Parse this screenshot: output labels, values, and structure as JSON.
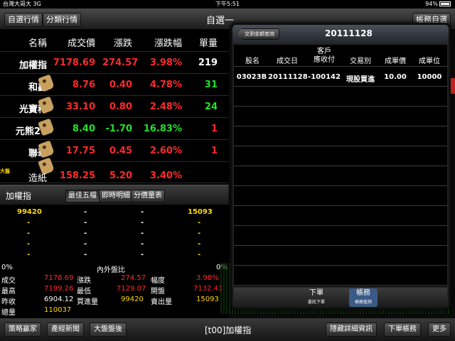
{
  "status": {
    "carrier": "台灣大哥大 3G",
    "time": "下午5:51",
    "battery": "94%"
  },
  "toolbar": {
    "left_tab_1": "自選行情",
    "left_tab_2": "分類行情",
    "title": "自選一",
    "right_btn": "帳務自選"
  },
  "quote_table": {
    "headers": [
      "名稱",
      "成交價",
      "漲跌",
      "漲跌幅",
      "單量"
    ],
    "rows": [
      {
        "name": "加權指",
        "price": "7178.69",
        "change": "274.57",
        "pct": "3.98%",
        "vol": "219"
      },
      {
        "name": "和鑫",
        "price": "8.76",
        "change": "0.40",
        "pct": "4.78%",
        "vol": "31"
      },
      {
        "name": "光寶科",
        "price": "33.10",
        "change": "0.80",
        "pct": "2.48%",
        "vol": "24"
      },
      {
        "name": "元熊21",
        "price": "8.40",
        "change": "-1.70",
        "pct": "16.83%",
        "vol": "1"
      },
      {
        "name": "聯華",
        "price": "17.75",
        "change": "0.45",
        "pct": "2.60%",
        "vol": "1"
      },
      {
        "name": "造紙",
        "price": "158.25",
        "change": "5.20",
        "pct": "3.40%",
        "badge": "大盤"
      }
    ]
  },
  "detail": {
    "title": "加權指",
    "tabs": [
      "最佳五檔",
      "即時明細",
      "分價量表"
    ],
    "orderbook": {
      "bid_vol": "99420",
      "ask_vol": "15093",
      "dash": "-"
    },
    "ratio_label": "內外盤比",
    "ratio_left": "0%",
    "ratio_right": "0%",
    "stats": [
      [
        "成交",
        "7178.69",
        "漲跌",
        "274.57",
        "幅度",
        "3.98%"
      ],
      [
        "最高",
        "7199.26",
        "最低",
        "7129.07",
        "開盤",
        "7132.41"
      ],
      [
        "昨收",
        "6904.12",
        "買進量",
        "99420",
        "賣出量",
        "15093"
      ],
      [
        "總量",
        "110037"
      ]
    ]
  },
  "popover": {
    "back_label": "交割金額查詢",
    "date": "20111128",
    "headers": [
      "股名",
      "成交日",
      "客戶\n應收付",
      "交易別",
      "成單價",
      "成單位"
    ],
    "rows": [
      [
        "03023B",
        "20111128",
        "-100142",
        "現股買進",
        "10.00",
        "10000"
      ]
    ],
    "footer_tabs": [
      {
        "big": "下單",
        "small": "委託下單"
      },
      {
        "big": "帳務",
        "small": "帳務查詢"
      }
    ]
  },
  "bottom": {
    "btn1": "策略贏家",
    "btn2": "產經新聞",
    "btn3": "大盤盤後",
    "title": "[t00]加權指",
    "btn4": "隱藏詳細資訊",
    "btn5": "下單帳務",
    "btn6": "更多"
  },
  "colors": {
    "up": "#ff2a2a",
    "down": "#22e02a",
    "accent": "#ffd800",
    "active_tab": "#3b5a86"
  }
}
